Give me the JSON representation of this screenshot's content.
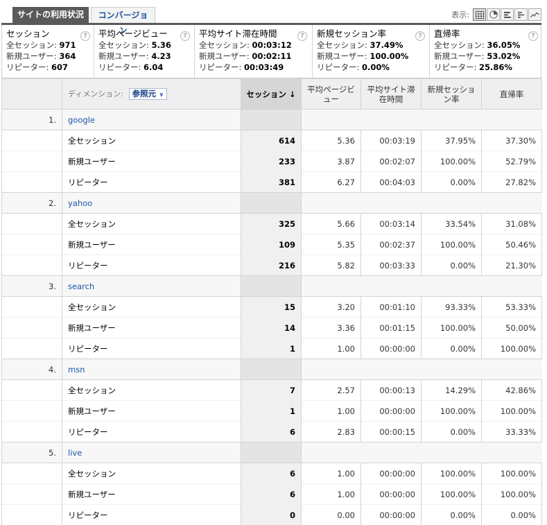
{
  "tabs": {
    "active": "サイトの利用状況",
    "inactive": "コンバージョン"
  },
  "view": {
    "label": "表示:",
    "buttons": [
      "table-icon",
      "pie-icon",
      "bar-icon",
      "compare-icon",
      "trend-icon"
    ]
  },
  "summary": [
    {
      "title": "セッション",
      "lines": [
        {
          "label": "全セッション:",
          "value": "971"
        },
        {
          "label": "新規ユーザー:",
          "value": "364"
        },
        {
          "label": "リピーター:",
          "value": "607"
        }
      ]
    },
    {
      "title": "平均ページビュー",
      "lines": [
        {
          "label": "全セッション:",
          "value": "5.36"
        },
        {
          "label": "新規ユーザー:",
          "value": "4.23"
        },
        {
          "label": "リピーター:",
          "value": "6.04"
        }
      ]
    },
    {
      "title": "平均サイト滞在時間",
      "lines": [
        {
          "label": "全セッション:",
          "value": "00:03:12"
        },
        {
          "label": "新規ユーザー:",
          "value": "00:02:11"
        },
        {
          "label": "リピーター:",
          "value": "00:03:49"
        }
      ]
    },
    {
      "title": "新規セッション率",
      "lines": [
        {
          "label": "全セッション:",
          "value": "37.49%"
        },
        {
          "label": "新規ユーザー:",
          "value": "100.00%"
        },
        {
          "label": "リピーター:",
          "value": "0.00%"
        }
      ]
    },
    {
      "title": "直帰率",
      "lines": [
        {
          "label": "全セッション:",
          "value": "36.05%"
        },
        {
          "label": "新規ユーザー:",
          "value": "53.02%"
        },
        {
          "label": "リピーター:",
          "value": "25.86%"
        }
      ]
    }
  ],
  "table": {
    "dimension_label": "ディメンション:",
    "dimension_value": "参照元",
    "headers": {
      "sessions": "セッション",
      "pageviews": "平均ページビュー",
      "duration": "平均サイト滞在時間",
      "new_rate": "新規セッション率",
      "bounce": "直帰率"
    },
    "groups": [
      {
        "index": "1.",
        "name": "google",
        "rows": [
          {
            "label": "全セッション",
            "sessions": "614",
            "pageviews": "5.36",
            "duration": "00:03:19",
            "new_rate": "37.95%",
            "bounce": "37.30%"
          },
          {
            "label": "新規ユーザー",
            "sessions": "233",
            "pageviews": "3.87",
            "duration": "00:02:07",
            "new_rate": "100.00%",
            "bounce": "52.79%"
          },
          {
            "label": "リピーター",
            "sessions": "381",
            "pageviews": "6.27",
            "duration": "00:04:03",
            "new_rate": "0.00%",
            "bounce": "27.82%"
          }
        ]
      },
      {
        "index": "2.",
        "name": "yahoo",
        "rows": [
          {
            "label": "全セッション",
            "sessions": "325",
            "pageviews": "5.66",
            "duration": "00:03:14",
            "new_rate": "33.54%",
            "bounce": "31.08%"
          },
          {
            "label": "新規ユーザー",
            "sessions": "109",
            "pageviews": "5.35",
            "duration": "00:02:37",
            "new_rate": "100.00%",
            "bounce": "50.46%"
          },
          {
            "label": "リピーター",
            "sessions": "216",
            "pageviews": "5.82",
            "duration": "00:03:33",
            "new_rate": "0.00%",
            "bounce": "21.30%"
          }
        ]
      },
      {
        "index": "3.",
        "name": "search",
        "rows": [
          {
            "label": "全セッション",
            "sessions": "15",
            "pageviews": "3.20",
            "duration": "00:01:10",
            "new_rate": "93.33%",
            "bounce": "53.33%"
          },
          {
            "label": "新規ユーザー",
            "sessions": "14",
            "pageviews": "3.36",
            "duration": "00:01:15",
            "new_rate": "100.00%",
            "bounce": "50.00%"
          },
          {
            "label": "リピーター",
            "sessions": "1",
            "pageviews": "1.00",
            "duration": "00:00:00",
            "new_rate": "0.00%",
            "bounce": "100.00%"
          }
        ]
      },
      {
        "index": "4.",
        "name": "msn",
        "rows": [
          {
            "label": "全セッション",
            "sessions": "7",
            "pageviews": "2.57",
            "duration": "00:00:13",
            "new_rate": "14.29%",
            "bounce": "42.86%"
          },
          {
            "label": "新規ユーザー",
            "sessions": "1",
            "pageviews": "1.00",
            "duration": "00:00:00",
            "new_rate": "100.00%",
            "bounce": "100.00%"
          },
          {
            "label": "リピーター",
            "sessions": "6",
            "pageviews": "2.83",
            "duration": "00:00:15",
            "new_rate": "0.00%",
            "bounce": "33.33%"
          }
        ]
      },
      {
        "index": "5.",
        "name": "live",
        "rows": [
          {
            "label": "全セッション",
            "sessions": "6",
            "pageviews": "1.00",
            "duration": "00:00:00",
            "new_rate": "100.00%",
            "bounce": "100.00%"
          },
          {
            "label": "新規ユーザー",
            "sessions": "6",
            "pageviews": "1.00",
            "duration": "00:00:00",
            "new_rate": "100.00%",
            "bounce": "100.00%"
          },
          {
            "label": "リピーター",
            "sessions": "0",
            "pageviews": "0.00",
            "duration": "00:00:00",
            "new_rate": "0.00%",
            "bounce": "0.00%"
          }
        ]
      }
    ]
  }
}
